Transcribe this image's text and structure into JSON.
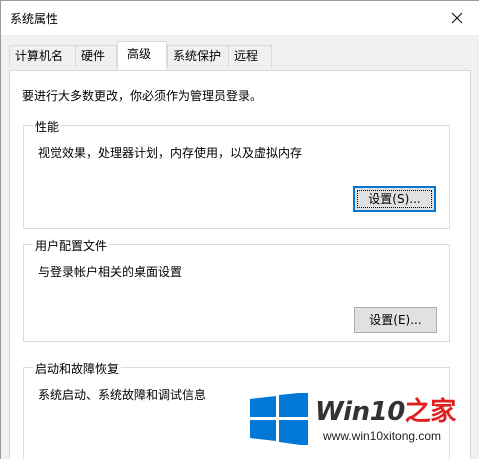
{
  "window": {
    "title": "系统属性"
  },
  "tabs": [
    {
      "label": "计算机名"
    },
    {
      "label": "硬件"
    },
    {
      "label": "高级"
    },
    {
      "label": "系统保护"
    },
    {
      "label": "远程"
    }
  ],
  "active_tab": "高级",
  "intro": "要进行大多数更改，你必须作为管理员登录。",
  "performance": {
    "title": "性能",
    "description": "视觉效果，处理器计划，内存使用，以及虚拟内存",
    "button": "设置(S)..."
  },
  "user_profiles": {
    "title": "用户配置文件",
    "description": "与登录帐户相关的桌面设置",
    "button": "设置(E)..."
  },
  "startup_recovery": {
    "title": "启动和故障恢复",
    "description": "系统启动、系统故障和调试信息"
  },
  "watermark": {
    "brand_prefix": "Win10",
    "brand_suffix": "之家",
    "url": "www.win10xitong.com",
    "logo_color": "#0078d7",
    "suffix_color": "#e02020",
    "logo_icon": "windows-logo-icon"
  }
}
